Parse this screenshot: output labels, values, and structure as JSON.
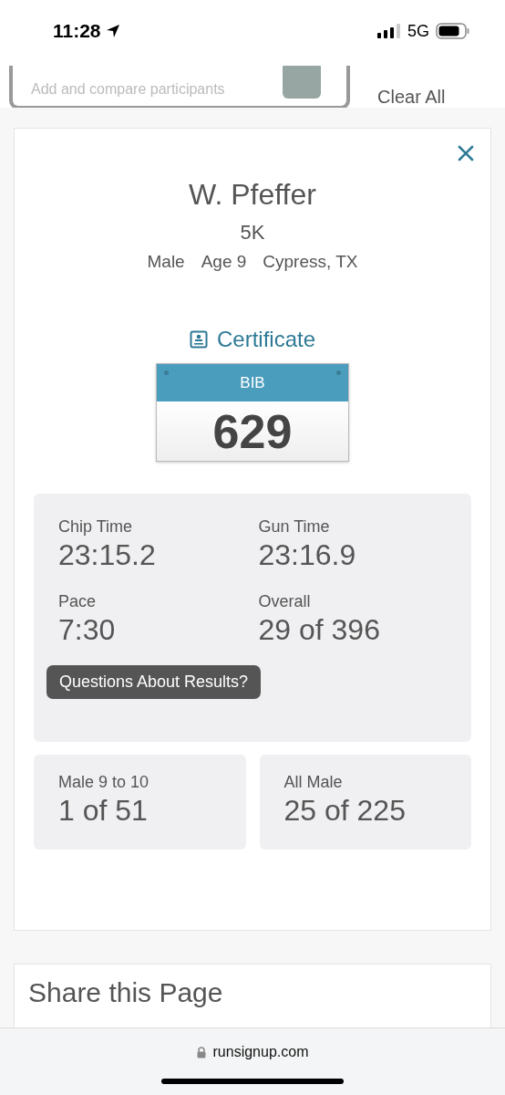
{
  "status_bar": {
    "time": "11:28",
    "network": "5G"
  },
  "compare": {
    "placeholder": "Add and compare participants",
    "clear_label": "Clear All"
  },
  "participant": {
    "name": "W. Pfeffer",
    "event": "5K",
    "details": [
      "Male",
      "Age 9",
      "Cypress, TX"
    ]
  },
  "certificate_label": "Certificate",
  "bib": {
    "label": "BIB",
    "number": "629"
  },
  "results": [
    {
      "label": "Chip Time",
      "value": "23:15.2"
    },
    {
      "label": "Gun Time",
      "value": "23:16.9"
    },
    {
      "label": "Pace",
      "value": "7:30"
    },
    {
      "label": "Overall",
      "value": "29 of 396"
    }
  ],
  "questions_button": "Questions About Results?",
  "divisions": [
    {
      "label": "Male 9 to 10",
      "value": "1 of 51"
    },
    {
      "label": "All Male",
      "value": "25 of 225"
    }
  ],
  "share": {
    "title": "Share this Page"
  },
  "browser": {
    "domain": "runsignup.com"
  }
}
